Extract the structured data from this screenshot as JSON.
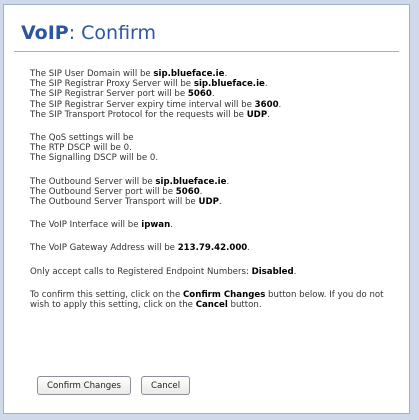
{
  "page": {
    "title_strong": "VoIP",
    "title_rest": ": Confirm"
  },
  "sip": {
    "domain_text": "The SIP User Domain will be ",
    "domain_val": "sip.blueface.ie",
    "proxy_text": "The SIP Registrar Proxy Server will be ",
    "proxy_val": "sip.blueface.ie",
    "port_text": "The SIP Registrar Server port will be ",
    "port_val": "5060",
    "expiry_text": "The SIP Registrar Server expiry time interval will be ",
    "expiry_val": "3600",
    "transport_text": "The SIP Transport Protocol for the requests will be ",
    "transport_val": "UDP"
  },
  "qos": {
    "line1": "The QoS settings will be",
    "line2": "The RTP DSCP will be 0.",
    "line3": "The Signalling DSCP will be 0."
  },
  "outbound": {
    "server_text": "The Outbound Server will be ",
    "server_val": "sip.blueface.ie",
    "port_text": "The Outbound Server port will be ",
    "port_val": "5060",
    "transport_text": "The Outbound Server Transport will be ",
    "transport_val": "UDP"
  },
  "interface": {
    "text": "The VoIP Interface will be ",
    "val": "ipwan"
  },
  "gateway": {
    "text": "The VoIP Gateway Address will be ",
    "val": "213.79.42.000"
  },
  "registered": {
    "text": "Only accept calls to Registered Endpoint Numbers: ",
    "val": "Disabled"
  },
  "instructions": {
    "p1": "To confirm this setting, click on the ",
    "confirm": "Confirm Changes",
    "p2": " button below. If you do not wish to apply this setting, click on the ",
    "cancel": "Cancel",
    "p3": " button."
  },
  "buttons": {
    "confirm": "Confirm Changes",
    "cancel": "Cancel"
  }
}
